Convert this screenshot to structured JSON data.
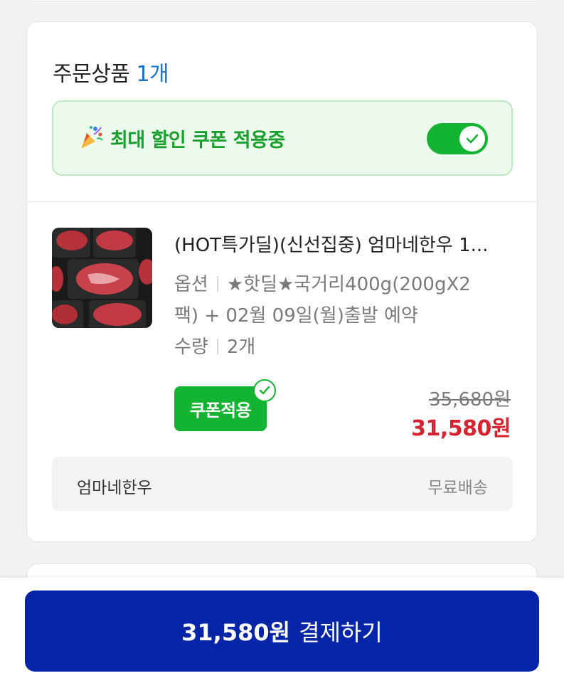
{
  "order": {
    "title": "주문상품",
    "count": "1개"
  },
  "coupon_banner": {
    "icon": "party-popper-icon",
    "text": "최대 할인 쿠폰 적용중",
    "toggle_on": true
  },
  "product": {
    "name": "(HOT특가딜)(신선집중) 엄마네한우 1...",
    "option_label": "옵션",
    "option_value_line1": "★핫딜★국거리400g(200gX2",
    "option_value_line2": "팩) + 02월 09일(월)출발 예약",
    "quantity_label": "수량",
    "quantity_value": "2개",
    "coupon_badge": "쿠폰적용",
    "original_price": "35,680원",
    "sale_price": "31,580원"
  },
  "seller": {
    "name": "엄마네한우",
    "shipping": "무료배송"
  },
  "pay": {
    "amount": "31,580원",
    "label": "결제하기"
  },
  "colors": {
    "accent_blue": "#0525a8",
    "count_blue": "#1a73c9",
    "green": "#12b432",
    "sale_red": "#d6232f"
  }
}
